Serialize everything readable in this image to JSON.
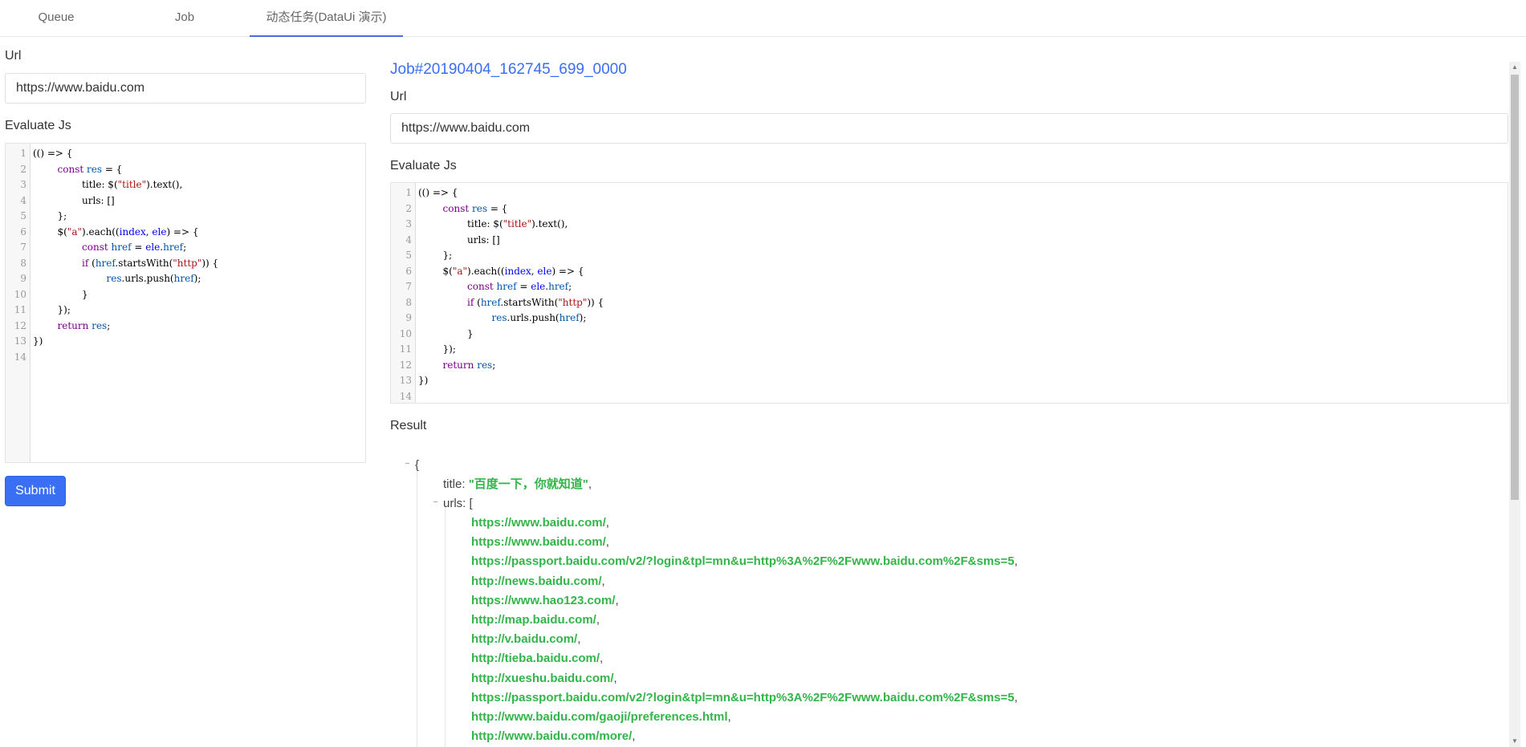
{
  "tabs": [
    {
      "label": "Queue",
      "active": false
    },
    {
      "label": "Job",
      "active": false
    },
    {
      "label": "动态任务(DataUi 演示)",
      "active": true
    }
  ],
  "left": {
    "url_label": "Url",
    "url_value": "https://www.baidu.com",
    "js_label": "Evaluate Js",
    "submit_label": "Submit"
  },
  "right": {
    "job_title": "Job#20190404_162745_699_0000",
    "url_label": "Url",
    "url_value": "https://www.baidu.com",
    "js_label": "Evaluate Js",
    "result_label": "Result"
  },
  "code_lines": [
    "(() => {",
    "        const res = {",
    "                title: $(\"title\").text(),",
    "                urls: []",
    "        };",
    "        $(\"a\").each((index, ele) => {",
    "                const href = ele.href;",
    "                if (href.startsWith(\"http\")) {",
    "                        res.urls.push(href);",
    "                }",
    "        });",
    "        return res;",
    "})",
    ""
  ],
  "line_numbers": [
    "1",
    "2",
    "3",
    "4",
    "5",
    "6",
    "7",
    "8",
    "9",
    "10",
    "11",
    "12",
    "13",
    "14"
  ],
  "result": {
    "open_brace": "{",
    "title_key": "title:",
    "title_value": "\"百度一下，你就知道\"",
    "urls_key": "urls:",
    "urls_open": "[",
    "comma": ",",
    "urls": [
      "https://www.baidu.com/",
      "https://www.baidu.com/",
      "https://passport.baidu.com/v2/?login&tpl=mn&u=http%3A%2F%2Fwww.baidu.com%2F&sms=5",
      "http://news.baidu.com/",
      "https://www.hao123.com/",
      "http://map.baidu.com/",
      "http://v.baidu.com/",
      "http://tieba.baidu.com/",
      "http://xueshu.baidu.com/",
      "https://passport.baidu.com/v2/?login&tpl=mn&u=http%3A%2F%2Fwww.baidu.com%2F&sms=5",
      "http://www.baidu.com/gaoji/preferences.html",
      "http://www.baidu.com/more/"
    ]
  },
  "colors": {
    "accent": "#3a6ff3",
    "json_string": "#33b54a",
    "code_keyword": "#770088",
    "code_def": "#0000ff",
    "code_string": "#aa1111"
  }
}
